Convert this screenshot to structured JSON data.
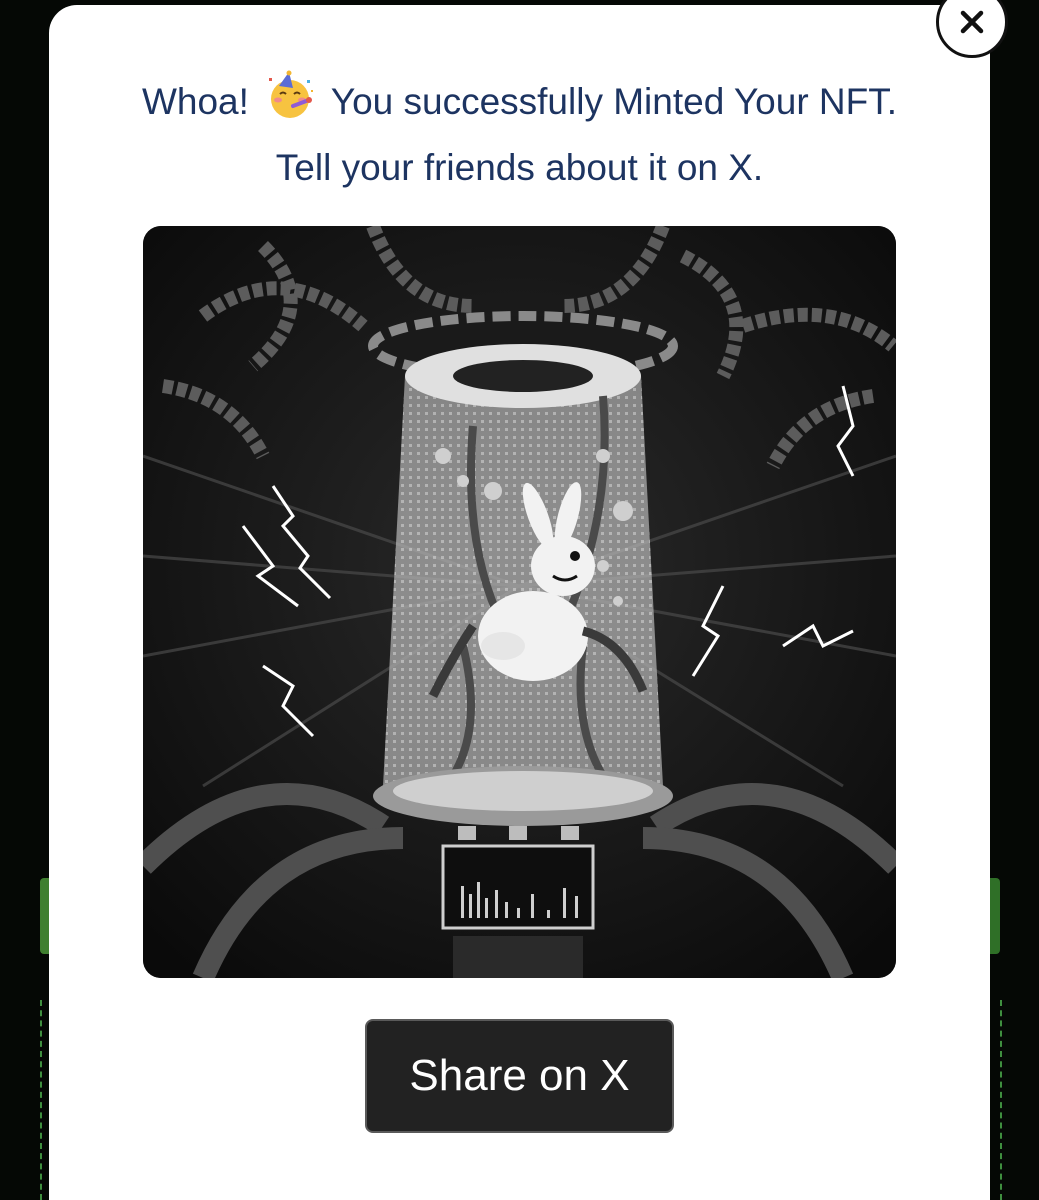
{
  "modal": {
    "headline_prefix": "Whoa!",
    "headline_rest": "You successfully Minted Your NFT.",
    "headline_line2": "Tell your friends about it on X.",
    "emoji": "partying-face-emoji",
    "close_icon": "close-icon",
    "share_button_label": "Share on X"
  },
  "nft_image": {
    "subject": "pixel-art rabbit in a glass chamber",
    "palette": [
      "#0d0d0d",
      "#3a3a3a",
      "#8a8a8a",
      "#e6e6e6"
    ]
  },
  "colors": {
    "headline": "#1d3461",
    "button_bg": "#222222",
    "button_text": "#ffffff",
    "modal_bg": "#ffffff",
    "accent_green": "#3f7f2f"
  }
}
